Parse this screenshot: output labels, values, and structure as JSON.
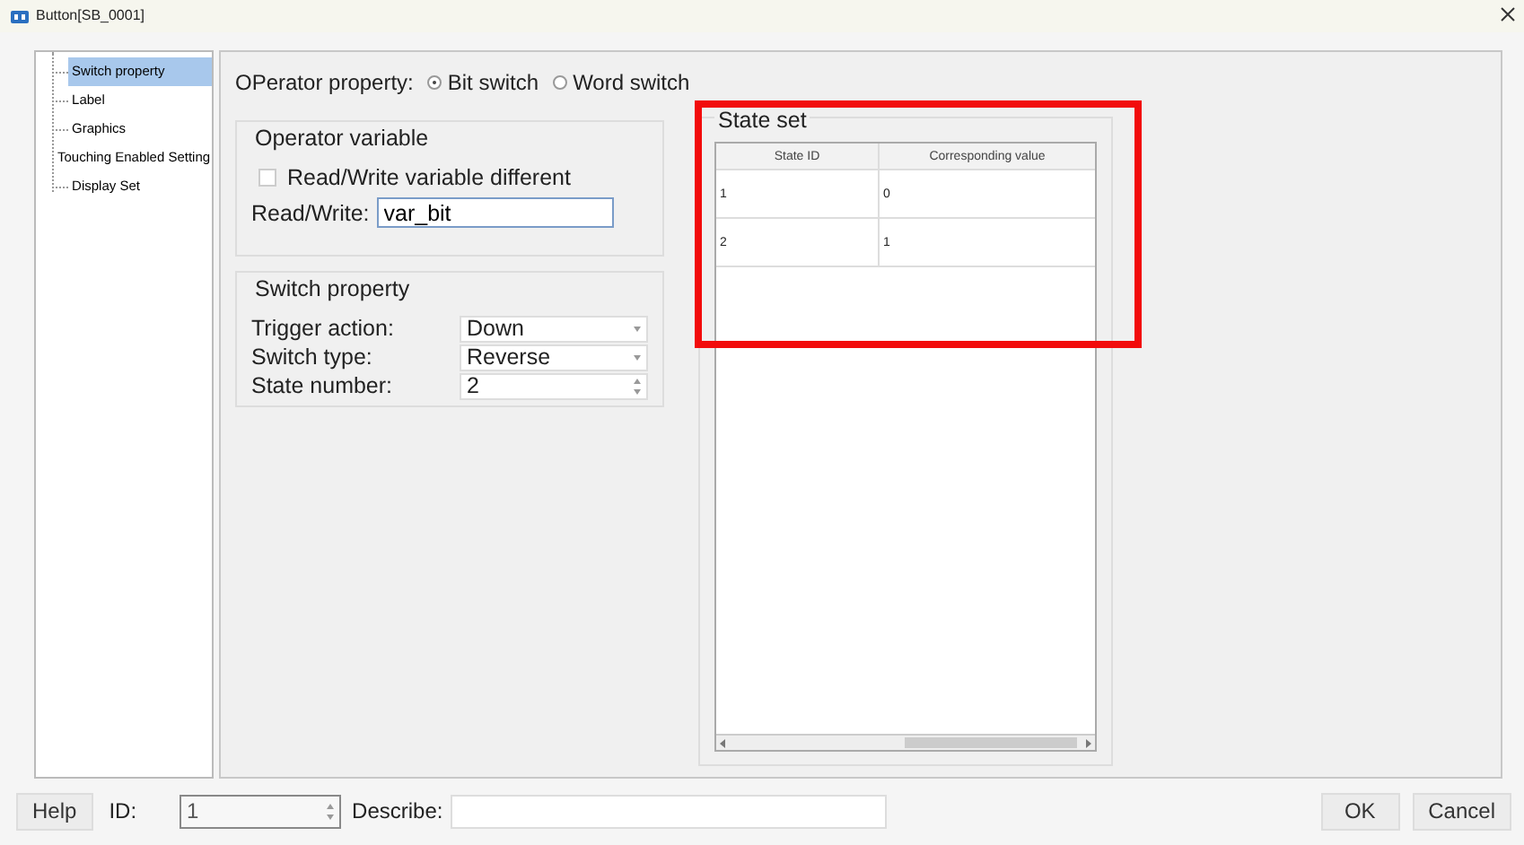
{
  "window": {
    "title": "Button[SB_0001]"
  },
  "sidebar": {
    "items": [
      {
        "label": "Switch property",
        "selected": true
      },
      {
        "label": "Label",
        "selected": false
      },
      {
        "label": "Graphics",
        "selected": false
      },
      {
        "label": "Touching Enabled Setting",
        "selected": false
      },
      {
        "label": "Display Set",
        "selected": false
      }
    ]
  },
  "operator_property": {
    "label": "OPerator property:",
    "options": [
      {
        "label": "Bit switch",
        "selected": true
      },
      {
        "label": "Word switch",
        "selected": false
      }
    ]
  },
  "operator_variable": {
    "title": "Operator variable",
    "checkbox": {
      "label": "Read/Write variable different",
      "checked": false
    },
    "read_write": {
      "label": "Read/Write:",
      "value": "var_bit"
    }
  },
  "switch_property": {
    "title": "Switch property",
    "fields": [
      {
        "label": "Trigger action:",
        "value": "Down",
        "kind": "dropdown"
      },
      {
        "label": "Switch type:",
        "value": "Reverse",
        "kind": "dropdown"
      },
      {
        "label": "State number:",
        "value": "2",
        "kind": "spinner"
      }
    ]
  },
  "state_set": {
    "title": "State set",
    "columns": [
      "State ID",
      "Corresponding value"
    ],
    "rows": [
      [
        "1",
        "0"
      ],
      [
        "2",
        "1"
      ]
    ]
  },
  "footer": {
    "help": "Help",
    "id": {
      "label": "ID:",
      "value": "1"
    },
    "describe": {
      "label": "Describe:"
    },
    "buttons": [
      "OK",
      "Cancel"
    ]
  }
}
